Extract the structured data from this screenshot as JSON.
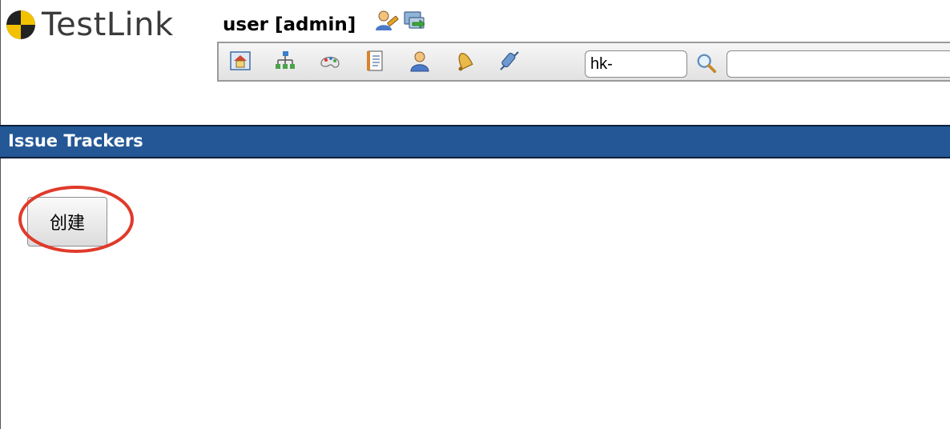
{
  "header": {
    "logo_text": "TestLink",
    "user_label": "user [admin]",
    "user_icons": [
      "edit-profile-icon",
      "logout-icon"
    ]
  },
  "toolbar": {
    "icons": [
      "home-icon",
      "test-specification-icon",
      "execute-icon",
      "reports-icon",
      "user-management-icon",
      "events-icon",
      "issue-tracker-icon"
    ],
    "testcase_id_value": "hk-",
    "search_icon": "magnifier-icon",
    "search_value": ""
  },
  "section": {
    "title": "Issue Trackers"
  },
  "main": {
    "create_button_label": "创建"
  },
  "colors": {
    "section_bar": "#235795",
    "highlight": "#e03a2a"
  }
}
